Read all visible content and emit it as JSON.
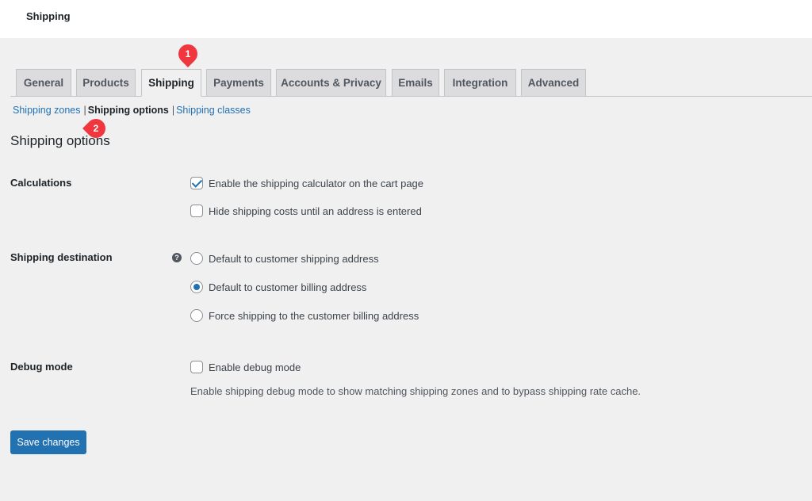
{
  "header": {
    "title": "Shipping"
  },
  "tabs": [
    {
      "label": "General",
      "active": false
    },
    {
      "label": "Products",
      "active": false
    },
    {
      "label": "Shipping",
      "active": true
    },
    {
      "label": "Payments",
      "active": false
    },
    {
      "label": "Accounts & Privacy",
      "active": false
    },
    {
      "label": "Emails",
      "active": false
    },
    {
      "label": "Integration",
      "active": false
    },
    {
      "label": "Advanced",
      "active": false
    }
  ],
  "subnav": {
    "items": [
      {
        "label": "Shipping zones",
        "current": false
      },
      {
        "label": "Shipping options",
        "current": true
      },
      {
        "label": "Shipping classes",
        "current": false
      }
    ],
    "separator": "|"
  },
  "page_title": "Shipping options",
  "calculations": {
    "label": "Calculations",
    "options": [
      {
        "label": "Enable the shipping calculator on the cart page",
        "checked": true
      },
      {
        "label": "Hide shipping costs until an address is entered",
        "checked": false
      }
    ]
  },
  "shipping_destination": {
    "label": "Shipping destination",
    "help_icon": "?",
    "options": [
      {
        "label": "Default to customer shipping address",
        "selected": false
      },
      {
        "label": "Default to customer billing address",
        "selected": true
      },
      {
        "label": "Force shipping to the customer billing address",
        "selected": false
      }
    ]
  },
  "debug_mode": {
    "label": "Debug mode",
    "option": {
      "label": "Enable debug mode",
      "checked": false
    },
    "description": "Enable shipping debug mode to show matching shipping zones and to bypass shipping rate cache."
  },
  "save_button": {
    "label": "Save changes"
  },
  "annotations": [
    {
      "number": "1",
      "color": "#f0373f"
    },
    {
      "number": "2",
      "color": "#f0373f"
    }
  ]
}
